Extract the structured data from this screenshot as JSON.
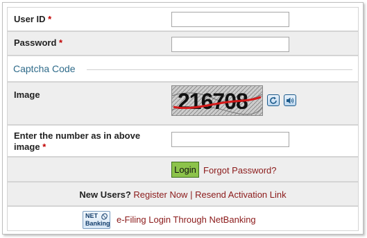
{
  "form": {
    "user_id_label": "User ID",
    "password_label": "Password",
    "required_marker": "*",
    "captcha_section_title": "Captcha Code",
    "image_label": "Image",
    "captcha_text": "216708",
    "captcha_input_label_line1": "Enter the number as in above",
    "captcha_input_label_line2": "image",
    "login_button": "Login",
    "forgot_password_link": "Forgot Password?",
    "user_id_value": "",
    "password_value": "",
    "captcha_value": ""
  },
  "new_users": {
    "prefix": "New Users?",
    "register_link": "Register Now",
    "separator": "|",
    "resend_link": "Resend Activation Link"
  },
  "netbanking": {
    "logo_line1": "NET",
    "logo_line2": "Banking",
    "link": "e-Filing Login Through NetBanking"
  },
  "icons": {
    "refresh": "refresh-icon",
    "audio": "speaker-icon",
    "netbanking_logo": "net-banking-logo"
  },
  "colors": {
    "required": "#c00000",
    "link": "#8b1a1a",
    "section_title": "#2f6b8a",
    "login_button": "#8cc34a"
  }
}
